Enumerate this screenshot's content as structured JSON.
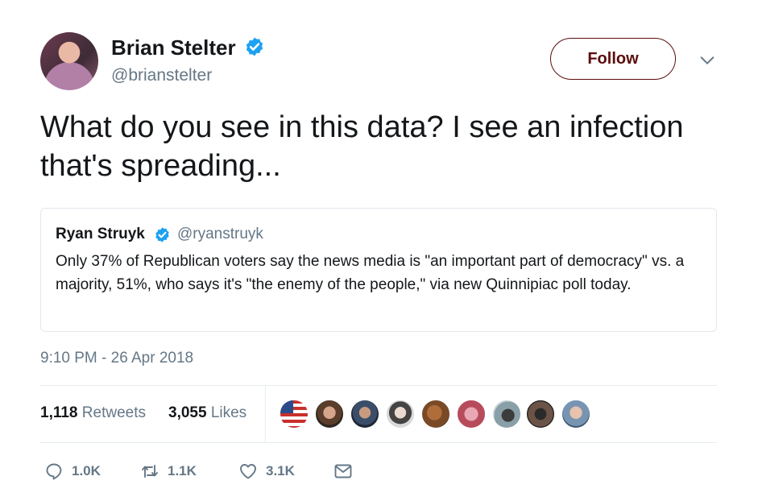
{
  "author": {
    "display_name": "Brian Stelter",
    "handle": "@brianstelter",
    "verified": true
  },
  "follow_button_label": "Follow",
  "tweet_text": "What do you see in this data? I see an infection that's spreading...",
  "quoted_tweet": {
    "display_name": "Ryan Struyk",
    "handle": "@ryanstruyk",
    "verified": true,
    "text": "Only 37% of Republican voters say the news media is \"an important part of democracy\" vs. a majority, 51%, who says it's \"the enemy of the people,\" via new Quinnipiac poll today."
  },
  "timestamp": "9:10 PM - 26 Apr 2018",
  "stats": {
    "retweets_count": "1,118",
    "retweets_label": "Retweets",
    "likes_count": "3,055",
    "likes_label": "Likes"
  },
  "actions": {
    "reply_count": "1.0K",
    "retweet_count": "1.1K",
    "like_count": "3.1K"
  },
  "colors": {
    "verified_blue": "#1da1f2",
    "follow_accent": "#5b0d0d",
    "secondary_text": "#657786"
  }
}
